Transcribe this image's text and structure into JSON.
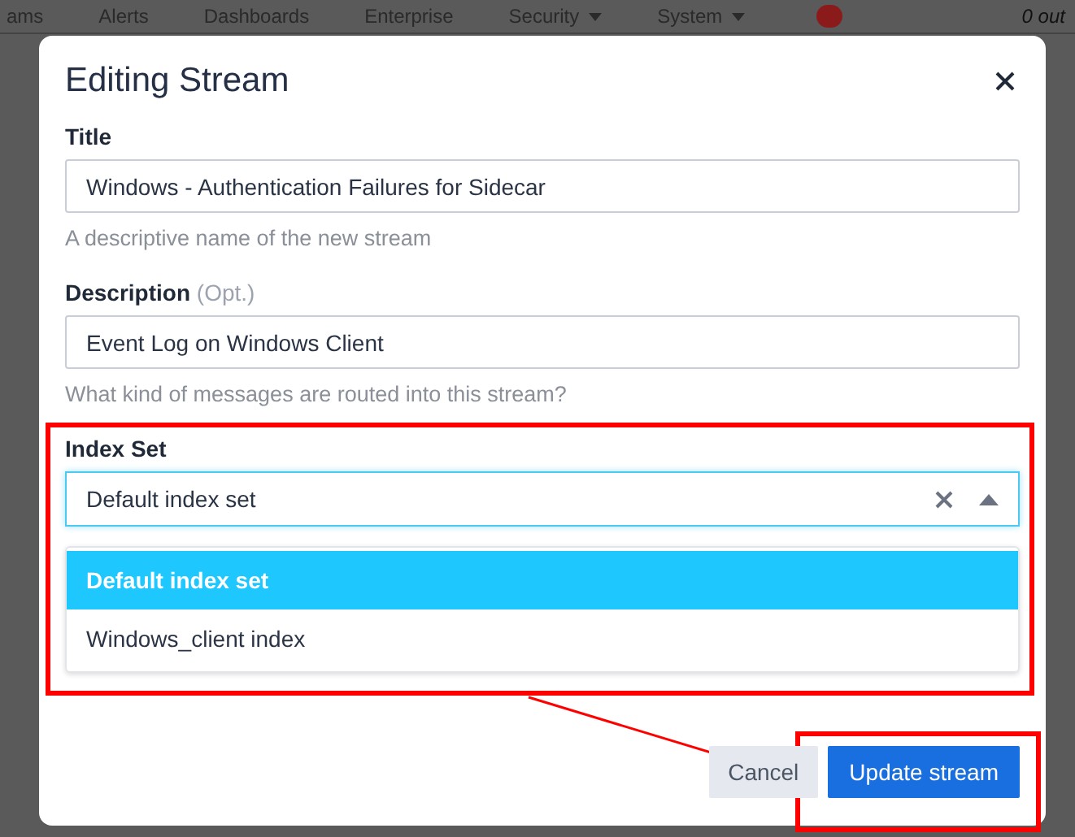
{
  "background_nav": {
    "items": [
      {
        "label": "ams",
        "dropdown": false
      },
      {
        "label": "Alerts",
        "dropdown": false
      },
      {
        "label": "Dashboards",
        "dropdown": false
      },
      {
        "label": "Enterprise",
        "dropdown": false
      },
      {
        "label": "Security",
        "dropdown": true
      },
      {
        "label": "System",
        "dropdown": true
      }
    ],
    "user_text": "0 out"
  },
  "dialog": {
    "title": "Editing Stream",
    "fields": [
      {
        "kind": "text",
        "label": "Title",
        "value": "Windows - Authentication Failures for Sidecar",
        "help": "A descriptive name of the new stream"
      },
      {
        "kind": "text",
        "label": "Description",
        "optional_note": "(Opt.)",
        "value": "Event Log on Windows Client",
        "help": "What kind of messages are routed into this stream?"
      },
      {
        "kind": "select",
        "label": "Index Set",
        "value": "Default index set",
        "open": true,
        "options": [
          {
            "label": "Default index set",
            "selected": true
          },
          {
            "label": "Windows_client index",
            "selected": false
          }
        ]
      }
    ],
    "buttons": [
      {
        "kind": "secondary",
        "label": "Cancel"
      },
      {
        "kind": "primary",
        "label": "Update stream"
      }
    ]
  },
  "annotations": [
    {
      "kind": "highlight_box"
    },
    {
      "kind": "highlight_box"
    },
    {
      "kind": "arrow"
    }
  ]
}
